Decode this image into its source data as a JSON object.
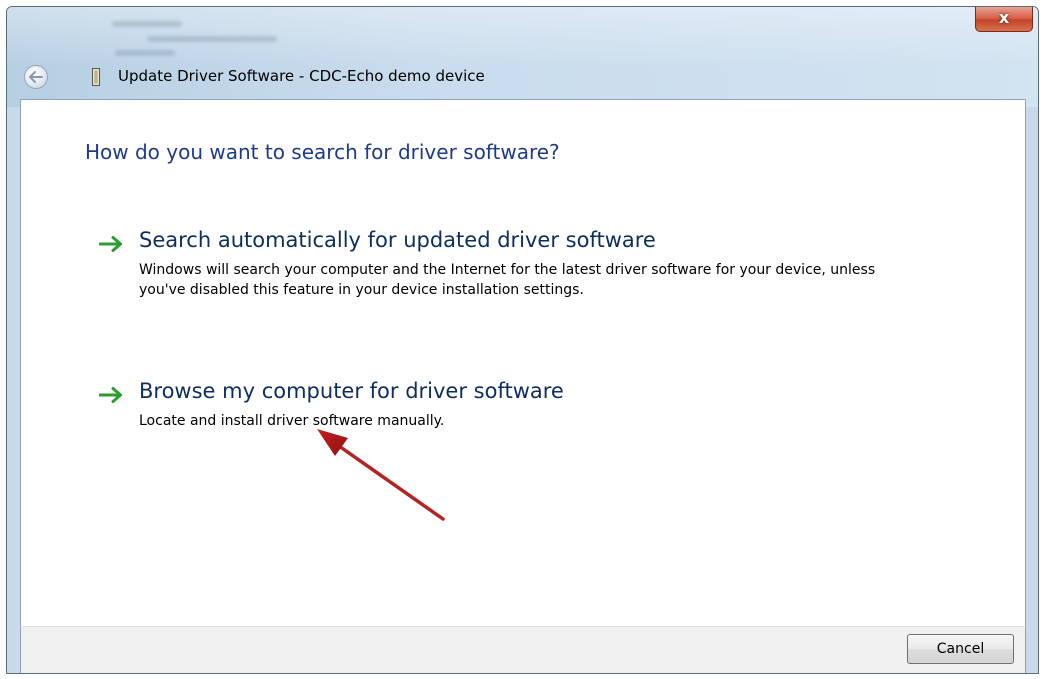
{
  "window": {
    "title": "Update Driver Software - CDC-Echo demo device",
    "close_label": "x"
  },
  "main": {
    "heading": "How do you want to search for driver software?",
    "options": [
      {
        "title": "Search automatically for updated driver software",
        "description": "Windows will search your computer and the Internet for the latest driver software for your device, unless you've disabled this feature in your device installation settings."
      },
      {
        "title": "Browse my computer for driver software",
        "description": "Locate and install driver software manually."
      }
    ]
  },
  "footer": {
    "cancel_label": "Cancel"
  },
  "icons": {
    "back": "back-arrow-icon",
    "device": "device-icon",
    "option_arrow": "green-arrow-icon",
    "annotation": "red-annotation-arrow"
  },
  "colors": {
    "heading": "#1e3a8a",
    "option_title": "#0c2e5e",
    "option_arrow": "#2e9c2e",
    "annotation_arrow": "#b01818",
    "close_button": "#c3452a"
  }
}
